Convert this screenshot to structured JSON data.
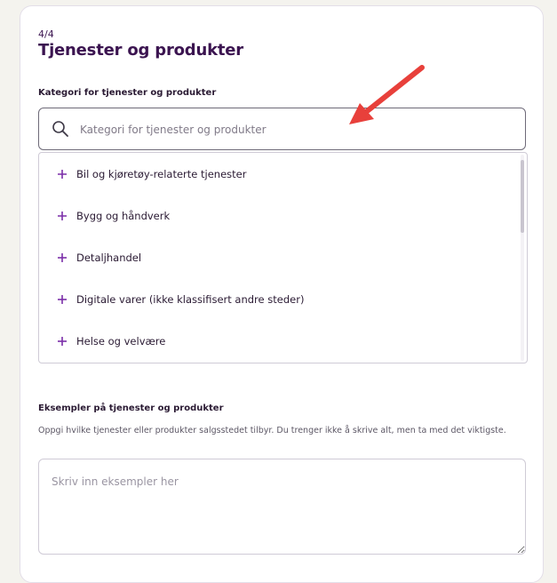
{
  "step": {
    "counter": "4/4"
  },
  "section": {
    "title": "Tjenester og produkter"
  },
  "category": {
    "label": "Kategori for tjenester og produkter",
    "search_placeholder": "Kategori for tjenester og produkter",
    "search_value": "",
    "search_icon": "search-icon",
    "options": [
      {
        "label": "Bil og kjøretøy-relaterte tjenester",
        "icon": "plus-icon"
      },
      {
        "label": "Bygg og håndverk",
        "icon": "plus-icon"
      },
      {
        "label": "Detaljhandel",
        "icon": "plus-icon"
      },
      {
        "label": "Digitale varer (ikke klassifisert andre steder)",
        "icon": "plus-icon"
      },
      {
        "label": "Helse og velvære",
        "icon": "plus-icon"
      }
    ]
  },
  "examples": {
    "label": "Eksempler på tjenester og produkter",
    "description": "Oppgi hvilke tjenester eller produkter salgsstedet tilbyr. Du trenger ikke å skrive alt, men ta med det viktigste.",
    "placeholder": "Skriv inn eksempler her",
    "value": ""
  },
  "colors": {
    "brand_purple": "#3b1450",
    "accent_plus": "#7b2fa8",
    "annotation_arrow": "#e8403b",
    "page_background": "#f4f3ee"
  }
}
